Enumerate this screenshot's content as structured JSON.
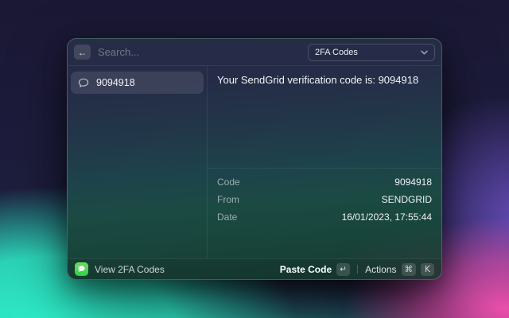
{
  "colors": {
    "accent_green": "#2fd04a",
    "wallpaper_navy": "#1b1936",
    "wallpaper_cyan": "#2ef2cc",
    "wallpaper_pink": "#f451b0",
    "wallpaper_purple": "#6f52c9",
    "window_top": "#272c47",
    "window_bottom": "#163830"
  },
  "icons": {
    "back": "←",
    "chevron_down": "chevron-down",
    "chat_bubble": "chat-bubble",
    "messages_app": "messages-app",
    "return_key": "↵",
    "command_key": "⌘"
  },
  "header": {
    "search_placeholder": "Search...",
    "dropdown_value": "2FA Codes"
  },
  "list": {
    "items": [
      {
        "icon": "chat-bubble",
        "label": "9094918",
        "selected": true
      }
    ]
  },
  "detail": {
    "message": "Your SendGrid verification code is: 9094918",
    "metadata": [
      {
        "label": "Code",
        "value": "9094918"
      },
      {
        "label": "From",
        "value": "SENDGRID"
      },
      {
        "label": "Date",
        "value": "16/01/2023, 17:55:44"
      }
    ]
  },
  "footer": {
    "title": "View 2FA Codes",
    "primary_action": {
      "label": "Paste Code",
      "key": "↵"
    },
    "actions": {
      "label": "Actions",
      "keys": [
        "⌘",
        "K"
      ]
    }
  }
}
